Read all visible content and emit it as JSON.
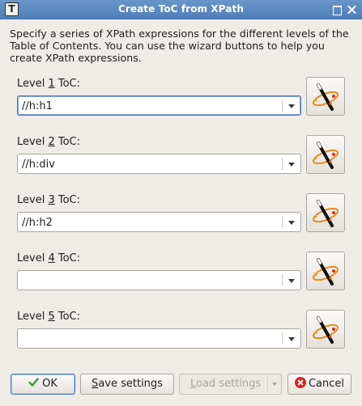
{
  "window": {
    "title": "Create ToC from XPath",
    "app_icon_letter": "T"
  },
  "intro_text": "Specify a series of XPath expressions for the different levels of the Table of Contents. You can use the wizard buttons to help you create XPath expressions.",
  "levels": [
    {
      "label_pre": "Level ",
      "label_key": "1",
      "label_post": " ToC:",
      "value": "//h:h1",
      "focused": true
    },
    {
      "label_pre": "Level ",
      "label_key": "2",
      "label_post": " ToC:",
      "value": "//h:div",
      "focused": false
    },
    {
      "label_pre": "Level ",
      "label_key": "3",
      "label_post": " ToC:",
      "value": "//h:h2",
      "focused": false
    },
    {
      "label_pre": "Level ",
      "label_key": "4",
      "label_post": " ToC:",
      "value": "",
      "focused": false
    },
    {
      "label_pre": "Level ",
      "label_key": "5",
      "label_post": " ToC:",
      "value": "",
      "focused": false
    }
  ],
  "buttons": {
    "ok_label": "OK",
    "save_key": "S",
    "save_rest": "ave settings",
    "load_key": "L",
    "load_rest": "oad settings",
    "cancel_label": "Cancel"
  },
  "icons": {
    "wizard": "magic-wand-icon",
    "ok": "check-icon",
    "cancel": "cancel-icon"
  },
  "colors": {
    "titlebar": "#5a88c0",
    "focus": "#4a7ab3",
    "cancel_red": "#d6281f",
    "ok_green": "#3c9a2e"
  }
}
